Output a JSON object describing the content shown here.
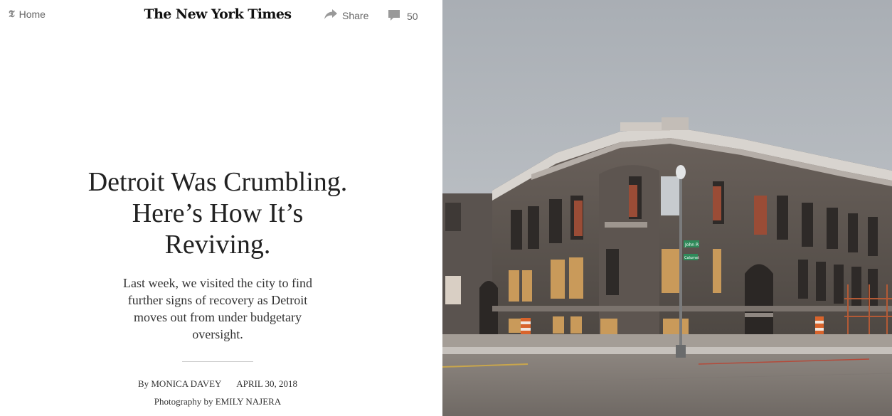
{
  "header": {
    "home_label": "Home",
    "masthead": "The New York Times",
    "share_label": "Share",
    "comment_count": "50",
    "icons": {
      "home": "nyt-t-icon",
      "share": "share-arrow-icon",
      "comments": "comment-bubble-icon"
    }
  },
  "article": {
    "headline": "Detroit Was Crumbling. Here’s How It’s Reviving.",
    "summary": "Last week, we visited the city to find further signs of recovery as Detroit moves out from under budgetary oversight.",
    "byline_prefix": "By",
    "author": "MONICA DAVEY",
    "date": "APRIL 30, 2018",
    "photo_credit": "Photography by EMILY NAJERA"
  },
  "photo": {
    "street_sign_top": "John R",
    "street_sign_bottom": "Calumet"
  },
  "colors": {
    "masthead": "#111111",
    "meta_text": "#666666",
    "sky": "#b9bec4",
    "brick": "#5e5651",
    "plywood": "#c99a5a"
  }
}
